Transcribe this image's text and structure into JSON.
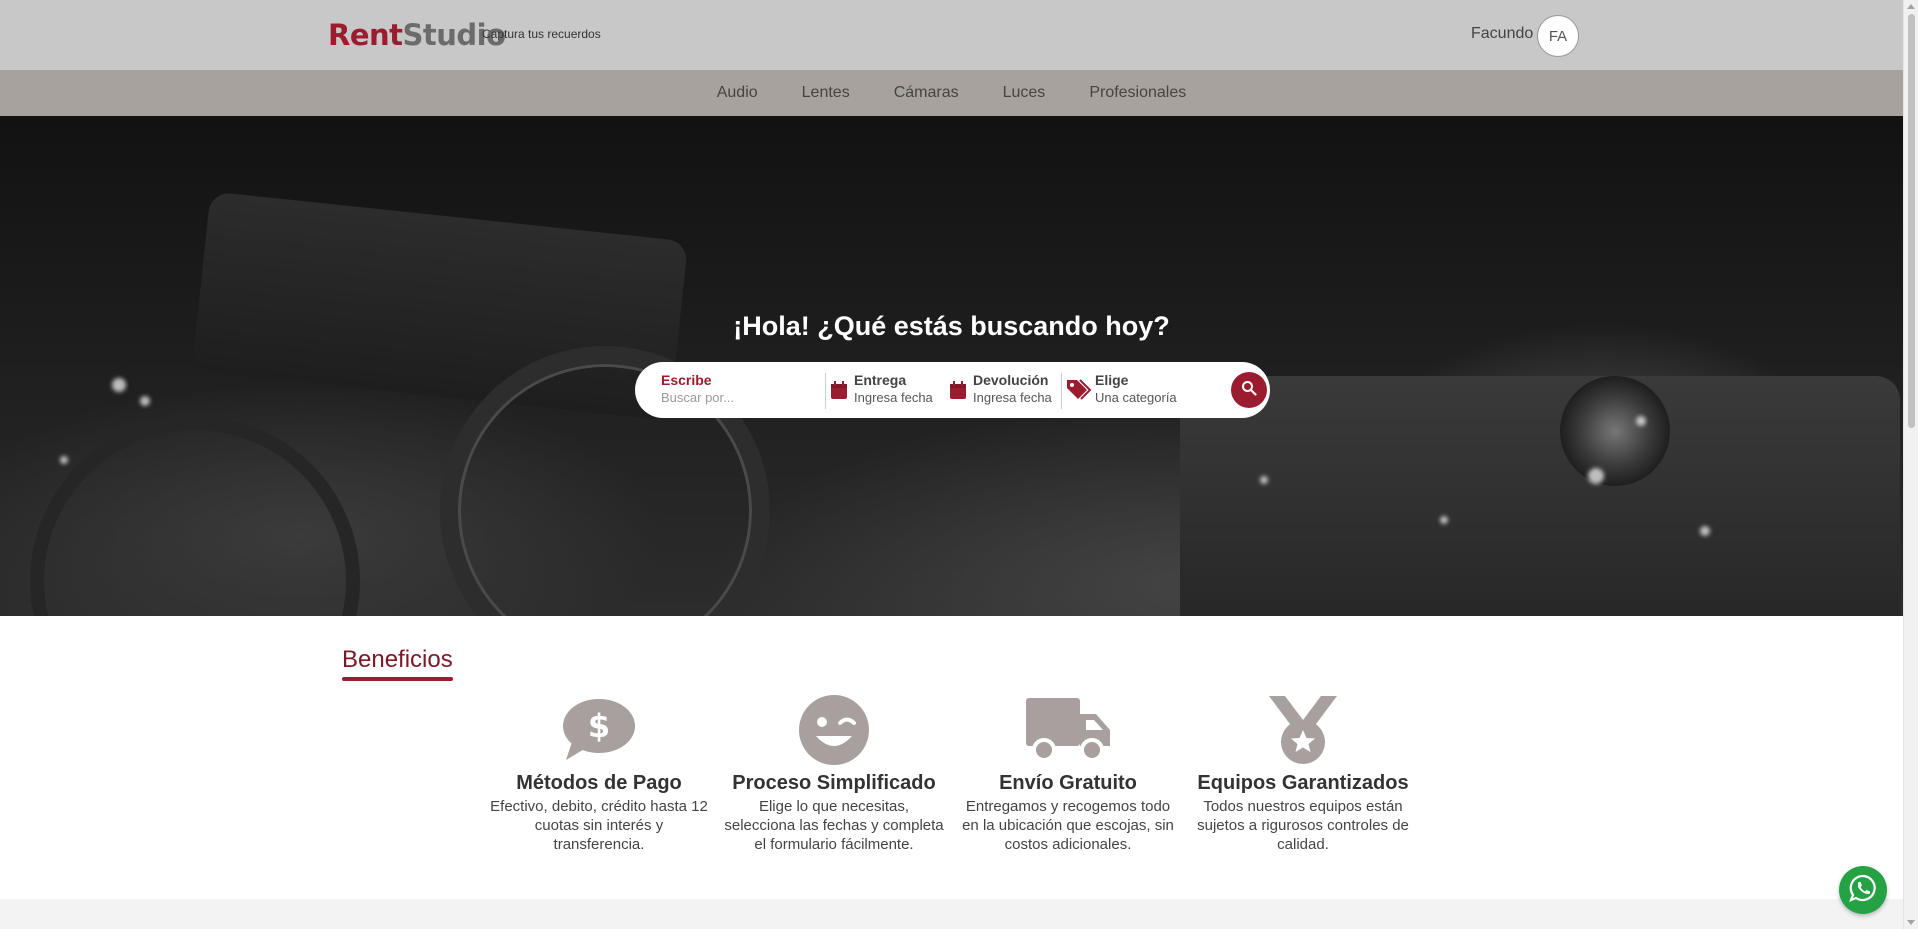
{
  "header": {
    "brand_part1": "Rent",
    "brand_part2": "Studio",
    "tagline": "Captura tus recuerdos",
    "user_name": "Facundo",
    "user_initials": "FA"
  },
  "nav": {
    "items": [
      {
        "label": "Audio"
      },
      {
        "label": "Lentes"
      },
      {
        "label": "Cámaras"
      },
      {
        "label": "Luces"
      },
      {
        "label": "Profesionales"
      }
    ]
  },
  "hero": {
    "title": "¡Hola! ¿Qué estás buscando hoy?",
    "search": {
      "write_label": "Escribe",
      "write_placeholder": "Buscar por...",
      "delivery_label": "Entrega",
      "delivery_value": "Ingresa fecha",
      "return_label": "Devolución",
      "return_value": "Ingresa fecha",
      "category_label": "Elige",
      "category_value": "Una categoría"
    }
  },
  "benefits": {
    "title": "Beneficios",
    "items": [
      {
        "name": "Métodos de Pago",
        "desc": "Efectivo, debito, crédito hasta 12 cuotas sin interés y transferencia.",
        "icon": "money-chat-icon"
      },
      {
        "name": "Proceso Simplificado",
        "desc": "Elige lo que necesitas, selecciona las fechas y completa el formulario fácilmente.",
        "icon": "wink-face-icon"
      },
      {
        "name": "Envío Gratuito",
        "desc": "Entregamos y recogemos todo en la ubicación que escojas, sin costos adicionales.",
        "icon": "truck-icon"
      },
      {
        "name": "Equipos Garantizados",
        "desc": "Todos nuestros equipos están sujetos a rigurosos controles de calidad.",
        "icon": "medal-icon"
      }
    ]
  },
  "colors": {
    "brand": "#9b1c2e",
    "header_bg": "#c8c8c8",
    "nav_bg": "#a7a29e",
    "icon_gray": "#a8a09e",
    "whatsapp": "#25a244"
  }
}
